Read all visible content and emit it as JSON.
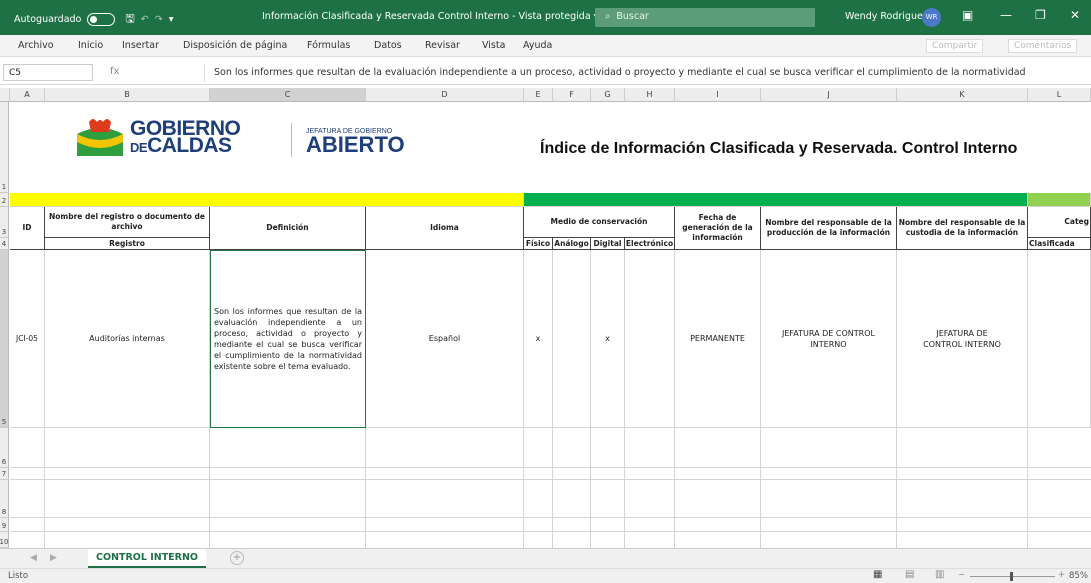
{
  "titlebar": {
    "autosave": "Autoguardado",
    "doc_title": "Información Clasificada y Reservada Control Interno  -  Vista protegida  ▾",
    "search": "Buscar",
    "user": "Wendy Rodriguez",
    "initials": "WR"
  },
  "menu": [
    "Archivo",
    "Inicio",
    "Insertar",
    "Disposición de página",
    "Fórmulas",
    "Datos",
    "Revisar",
    "Vista",
    "Ayuda"
  ],
  "menu_right": {
    "share": "Compartir",
    "comments": "Comentarios"
  },
  "formula": {
    "cell_ref": "C5",
    "fx": "fx",
    "content": "Son los informes que resultan de la evaluación independiente a un proceso, actividad o  proyecto y mediante el cual se busca verificar el cumplimiento de la normatividad"
  },
  "columns": [
    "A",
    "B",
    "C",
    "D",
    "E",
    "F",
    "G",
    "H",
    "I",
    "J",
    "K",
    "L"
  ],
  "rows": [
    "1",
    "2",
    "3",
    "4",
    "5",
    "6",
    "7",
    "8",
    "9",
    "10"
  ],
  "logo": {
    "line1": "GOBIERNO",
    "line2_prefix": "DE",
    "line2": "CALDAS",
    "sub_small": "JEFATURA DE GOBIERNO",
    "sub_big": "ABIERTO"
  },
  "sheet_title": "Índice de Información Clasificada y Reservada. Control Interno",
  "headers": {
    "id": "ID",
    "nombre": "Nombre del registro o documento de archivo",
    "registro": "Registro",
    "definicion": "Definición",
    "idioma": "Idioma",
    "medio": "Medio de conservación",
    "fisico": "Físico",
    "analogo": "Análogo",
    "digital": "Digital",
    "electronico": "Electrónico",
    "fecha": "Fecha de generación de la información",
    "resp_prod": "Nombre del responsable de la producción de la información",
    "resp_cust": "Nombre del responsable de la custodia de la información",
    "categ": "Categ",
    "clasificada": "Clasificada"
  },
  "row5": {
    "id": "JCI-05",
    "nombre": "Auditorías internas",
    "definicion": "Son los informes que resultan de la evaluación independiente a un proceso, actividad o proyecto y mediante el cual se busca verificar el cumplimiento de la normatividad existente sobre el tema evaluado.",
    "idioma": "Español",
    "fisico": "x",
    "digital": "x",
    "fecha": "PERMANENTE",
    "resp_prod": "JEFATURA DE CONTROL INTERNO",
    "resp_cust": "JEFATURA DE CONTROL INTERNO"
  },
  "tab": "CONTROL INTERNO",
  "status": {
    "ready": "Listo",
    "zoom": "85%"
  },
  "colors": {
    "excel_green": "#1e7145",
    "yellow": "#ffff00",
    "green": "#00b050"
  }
}
